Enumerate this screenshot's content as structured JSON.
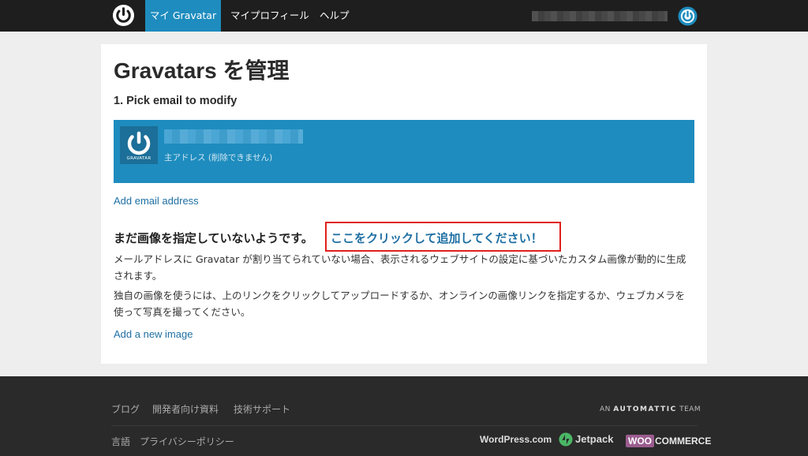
{
  "nav": {
    "tabs": [
      {
        "label": "マイ Gravatar",
        "active": true
      },
      {
        "label": "マイプロフィール",
        "active": false
      },
      {
        "label": "ヘルプ",
        "active": false
      }
    ]
  },
  "main": {
    "title": "Gravatars を管理",
    "step_title": "1. Pick email to modify",
    "email_card": {
      "logo_text": "GRAVATAR",
      "subtitle": "主アドレス (削除できません)"
    },
    "add_email_link": "Add email address",
    "no_image_heading": "まだ画像を指定していないようです。",
    "click_to_add_link": "ここをクリックして追加してください！",
    "paragraph_1": "メールアドレスに Gravatar が割り当てられていない場合、表示されるウェブサイトの設定に基づいたカスタム画像が動的に生成されます。",
    "paragraph_2": "独自の画像を使うには、上のリンクをクリックしてアップロードするか、オンラインの画像リンクを指定するか、ウェブカメラを使って写真を撮ってください。",
    "add_image_link": "Add a new image"
  },
  "footer": {
    "links_row1": [
      "ブログ",
      "開発者向け資料",
      "技術サポート"
    ],
    "links_row2": [
      "言語",
      "プライバシーポリシー"
    ],
    "automattic": {
      "prefix": "AN",
      "brand": "AUTOMATTIC",
      "suffix": "TEAM"
    },
    "wordpress": "WordPress.com",
    "jetpack": "Jetpack",
    "woo_badge": "WOO",
    "woo_text": "COMMERCE"
  },
  "colors": {
    "topbar": "#1e1e1e",
    "accent": "#1e8cbe",
    "link": "#1e6fa3",
    "highlight_box": "#e0201c",
    "footer": "#2a2a2a",
    "woo": "#9b5c8f"
  }
}
